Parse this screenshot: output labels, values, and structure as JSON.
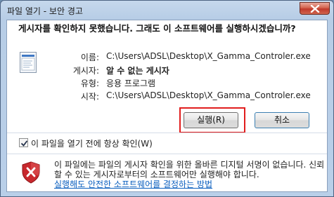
{
  "window": {
    "title": "파일 열기 - 보안 경고",
    "close_icon": "close-icon"
  },
  "dialog": {
    "headline": "게시자를 확인하지 못했습니다. 그래도 이 소프트웨어를 실행하시겠습니까?",
    "details": {
      "name_label": "이름:",
      "name_value": "C:\\Users\\ADSL\\Desktop\\X_Gamma_Controler.exe",
      "publisher_label": "게시자:",
      "publisher_value": "알 수 없는 게시자",
      "type_label": "유형:",
      "type_value": "응용 프로그램",
      "from_label": "시작:",
      "from_value": "C:\\Users\\ADSL\\Desktop\\X_Gamma_Controler.exe"
    },
    "buttons": {
      "run": "실행(R)",
      "cancel": "취소"
    },
    "checkbox": {
      "label": "이 파일을 열기 전에 항상 확인(W)",
      "checked": true
    },
    "warning": {
      "text": "이 파일에는 파일의 게시자 확인을 위한 올바른 디지털 서명이 없습니다. 신뢰할 수 있는 게시자로부터의 소프트웨어만 실행해야 합니다.",
      "link": "실행해도 안전한 소프트웨어를 결정하는 방법"
    }
  },
  "colors": {
    "highlight": "#e11d1d",
    "link": "#0b5fbf",
    "shield_red": "#c8282d"
  }
}
